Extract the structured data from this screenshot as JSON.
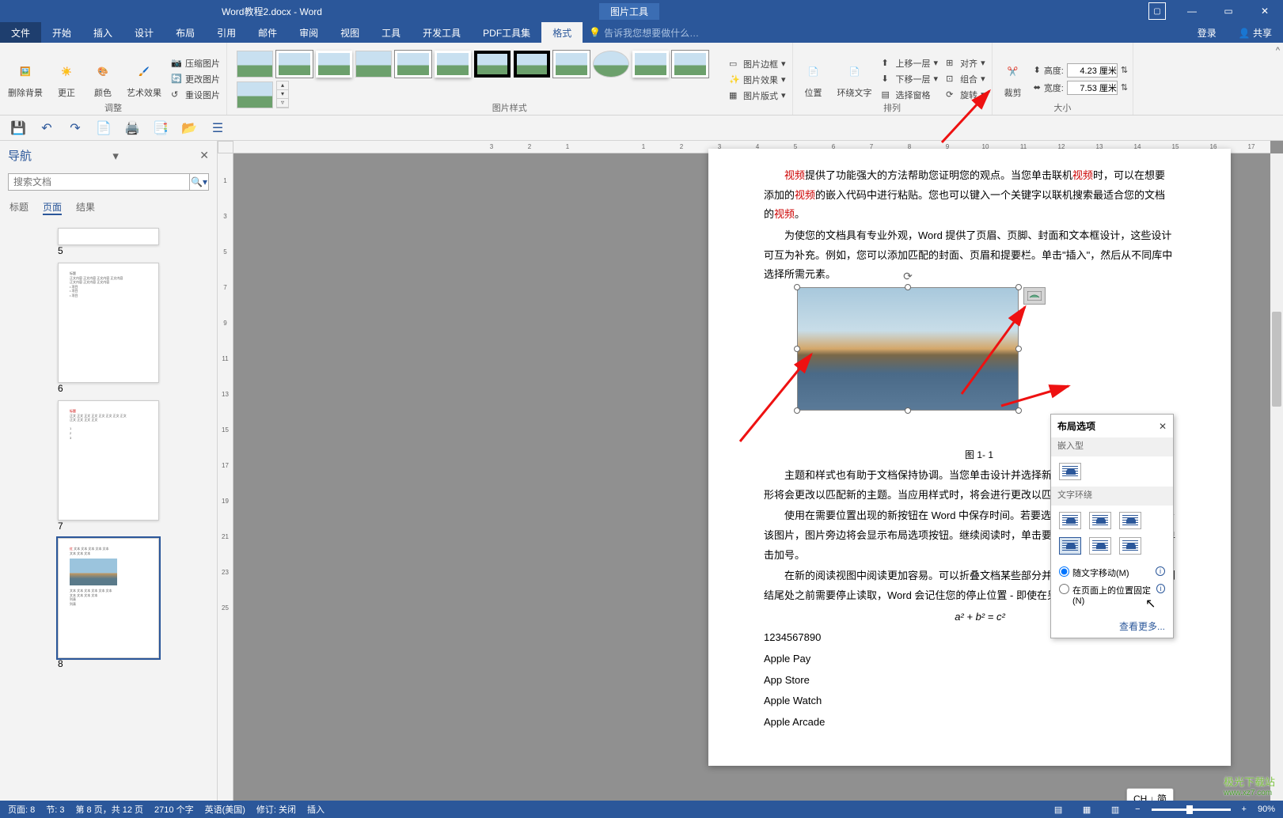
{
  "title": "Word教程2.docx - Word",
  "contextual_tab": "图片工具",
  "menubar": {
    "file": "文件",
    "tabs": [
      "开始",
      "插入",
      "设计",
      "布局",
      "引用",
      "邮件",
      "审阅",
      "视图",
      "工具",
      "开发工具",
      "PDF工具集",
      "格式"
    ],
    "active_index": 11,
    "tell_me": "告诉我您想要做什么…",
    "login": "登录",
    "share": "共享"
  },
  "ribbon": {
    "adjust": {
      "label": "调整",
      "remove_bg": "删除背景",
      "corrections": "更正",
      "color": "颜色",
      "artistic": "艺术效果",
      "compress": "压缩图片",
      "change": "更改图片",
      "reset": "重设图片"
    },
    "styles": {
      "label": "图片样式",
      "border": "图片边框",
      "effects": "图片效果",
      "layout": "图片版式"
    },
    "arrange": {
      "label": "排列",
      "position": "位置",
      "wrap": "环绕文字",
      "bring_fwd": "上移一层",
      "send_back": "下移一层",
      "selection": "选择窗格",
      "align": "对齐",
      "group": "组合",
      "rotate": "旋转"
    },
    "size": {
      "label": "大小",
      "crop": "裁剪",
      "height_l": "高度:",
      "width_l": "宽度:",
      "height": "4.23 厘米",
      "width": "7.53 厘米"
    }
  },
  "nav": {
    "title": "导航",
    "search_ph": "搜索文档",
    "tabs": [
      "标题",
      "页面",
      "结果"
    ],
    "active_tab": 1,
    "pages": [
      "5",
      "6",
      "7",
      "8"
    ],
    "selected": 3
  },
  "ruler_ticks": [
    "3",
    "2",
    "1",
    "",
    "1",
    "2",
    "3",
    "4",
    "5",
    "6",
    "7",
    "8",
    "9",
    "10",
    "11",
    "12",
    "13",
    "14",
    "15",
    "16",
    "17"
  ],
  "doc": {
    "p1_a": "视频",
    "p1_b": "提供了功能强大的方法帮助您证明您的观点。当您单击联机",
    "p1_c": "视频",
    "p1_d": "时，可以在想要添加的",
    "p1_e": "视频",
    "p1_f": "的嵌入代码中进行粘贴。您也可以键入一个关键字以联机搜索最适合您的文档的",
    "p1_g": "视频",
    "p1_h": "。",
    "p2": "为使您的文档具有专业外观，Word 提供了页眉、页脚、封面和文本框设计，这些设计可互为补充。例如，您可以添加匹配的封面、页眉和提要栏。单击\"插入\"，然后从不同库中选择所需元素。",
    "cap": "图 1- 1",
    "p3": "主题和样式也有助于文档保持协调。当您单击设计并选择新图片、图表或 SmartArt 图形将会更改以匹配新的主题。当应用样式时，将会进行更改以匹配新的主题。",
    "p4": "使用在需要位置出现的新按钮在 Word 中保存时间。若要选择适应文档的方式，请单击该图片，图片旁边将会显示布局选项按钮。继续阅读时，单击要添加行或列的位置，然后单击加号。",
    "p5": "在新的阅读视图中阅读更加容易。可以折叠文档某些部分并关注所需文本。如果在达到结尾处之前需要停止读取，Word 会记住您的停止位置 - 即使在另一个设备上。",
    "eq": "a² + b² = c²",
    "list": [
      "1234567890",
      "Apple Pay",
      "App Store",
      "Apple Watch",
      "Apple Arcade"
    ]
  },
  "popup": {
    "title": "布局选项",
    "inline": "嵌入型",
    "wrap": "文字环绕",
    "r1": "随文字移动(M)",
    "r2": "在页面上的位置固定(N)",
    "more": "查看更多..."
  },
  "ime": "CH ↓ 简",
  "status": {
    "page": "页面: 8",
    "sec": "节: 3",
    "pages": "第 8 页，共 12 页",
    "words": "2710 个字",
    "lang": "英语(美国)",
    "track": "修订: 关闭",
    "insert": "插入",
    "zoom": "90%"
  },
  "watermark": {
    "a": "极光下载站",
    "b": "www.xz7.com"
  }
}
